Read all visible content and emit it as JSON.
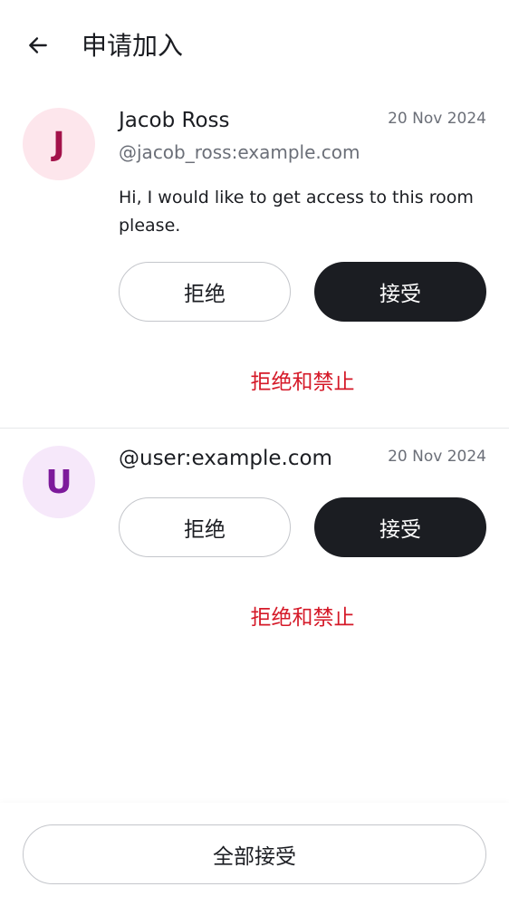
{
  "header": {
    "title": "申请加入",
    "back_icon": "arrow-left-icon"
  },
  "requests": [
    {
      "avatar_letter": "J",
      "avatar_bg": "#fde6ec",
      "avatar_fg": "#a3124a",
      "name": "Jacob Ross",
      "handle": "@jacob_ross:example.com",
      "date": "20 Nov 2024",
      "message": "Hi, I would like to get access to this room please.",
      "decline_label": "拒绝",
      "accept_label": "接受",
      "ban_label": "拒绝和禁止"
    },
    {
      "avatar_letter": "U",
      "avatar_bg": "#f6e8fa",
      "avatar_fg": "#7d1a9b",
      "name": "@user:example.com",
      "date": "20 Nov 2024",
      "decline_label": "拒绝",
      "accept_label": "接受",
      "ban_label": "拒绝和禁止"
    }
  ],
  "footer": {
    "accept_all_label": "全部接受"
  },
  "colors": {
    "danger": "#d51928",
    "primary_button": "#1b1d22",
    "secondary_text": "#6b6f78"
  }
}
